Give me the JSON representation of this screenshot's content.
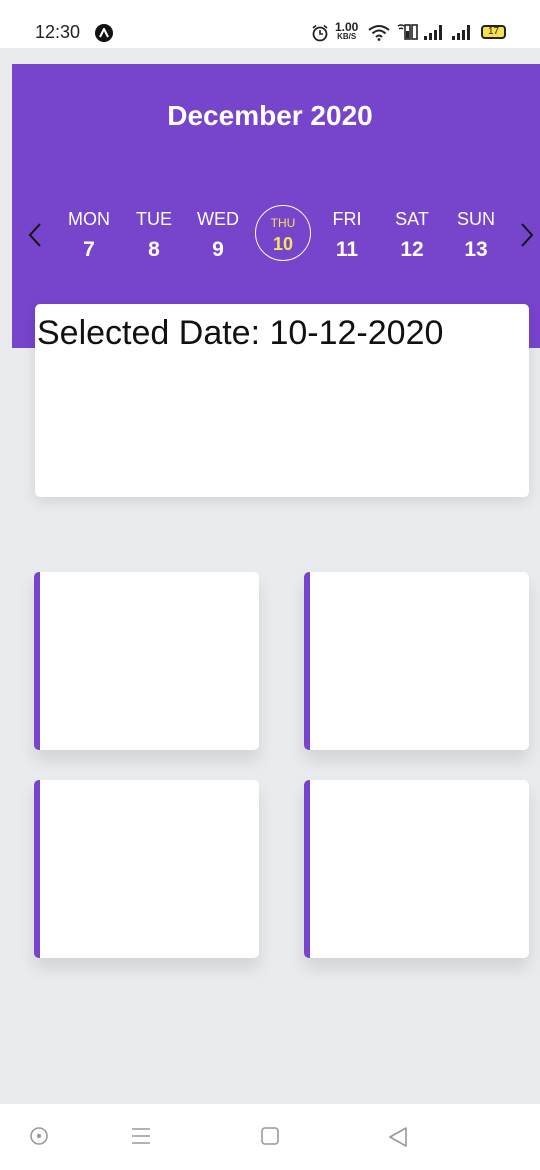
{
  "status_bar": {
    "time": "12:30",
    "net_speed_value": "1.00",
    "net_speed_unit": "KB/S",
    "battery": "17",
    "icons": [
      "navigation-badge-icon",
      "alarm-icon",
      "wifi-icon",
      "volte-icon",
      "signal-icon",
      "signal-icon",
      "battery-icon"
    ]
  },
  "header": {
    "month_title": "December 2020",
    "prev_icon": "chevron-left-icon",
    "next_icon": "chevron-right-icon",
    "days": [
      {
        "name": "MON",
        "num": "7"
      },
      {
        "name": "TUE",
        "num": "8"
      },
      {
        "name": "WED",
        "num": "9"
      },
      {
        "name": "THU",
        "num": "10",
        "selected": true
      },
      {
        "name": "FRI",
        "num": "11"
      },
      {
        "name": "SAT",
        "num": "12"
      },
      {
        "name": "SUN",
        "num": "13"
      }
    ]
  },
  "selected_card": {
    "text": "Selected Date: 10-12-2020"
  },
  "colors": {
    "accent": "#7744cc",
    "selected_day_text": "#f6e45a",
    "background": "#e9ebec"
  },
  "bottom_nav": {
    "icons": [
      "assistant-circle-icon",
      "recent-apps-icon",
      "home-icon",
      "back-icon"
    ]
  }
}
